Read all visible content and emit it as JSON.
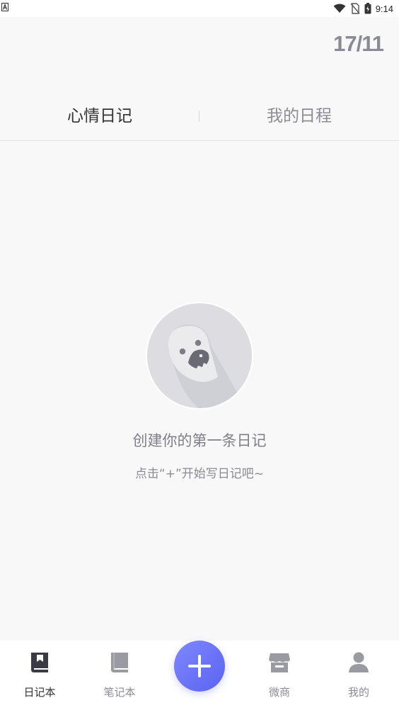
{
  "status_bar": {
    "time": "9:14",
    "icons": [
      "wifi-icon",
      "no-sim-icon",
      "battery-icon"
    ]
  },
  "header": {
    "date": "17/11"
  },
  "tabs": [
    {
      "label": "心情日记",
      "active": true
    },
    {
      "label": "我的日程",
      "active": false
    }
  ],
  "empty_state": {
    "title": "创建你的第一条日记",
    "subtitle": "点击“+”开始写日记吧~",
    "illustration": "ghost-illustration"
  },
  "bottom_nav": {
    "items": [
      {
        "label": "日记本",
        "icon": "diary-book-icon",
        "active": true
      },
      {
        "label": "笔记本",
        "icon": "notebook-icon",
        "active": false
      },
      {
        "label": "微商",
        "icon": "store-icon",
        "active": false
      },
      {
        "label": "我的",
        "icon": "person-icon",
        "active": false
      }
    ],
    "fab_icon": "plus-icon"
  },
  "colors": {
    "accent": "#6a72f6",
    "background": "#f8f8f9",
    "muted_text": "#8c8c94",
    "icon_gray": "#9a9aa2",
    "icon_dark": "#3a3a44"
  }
}
